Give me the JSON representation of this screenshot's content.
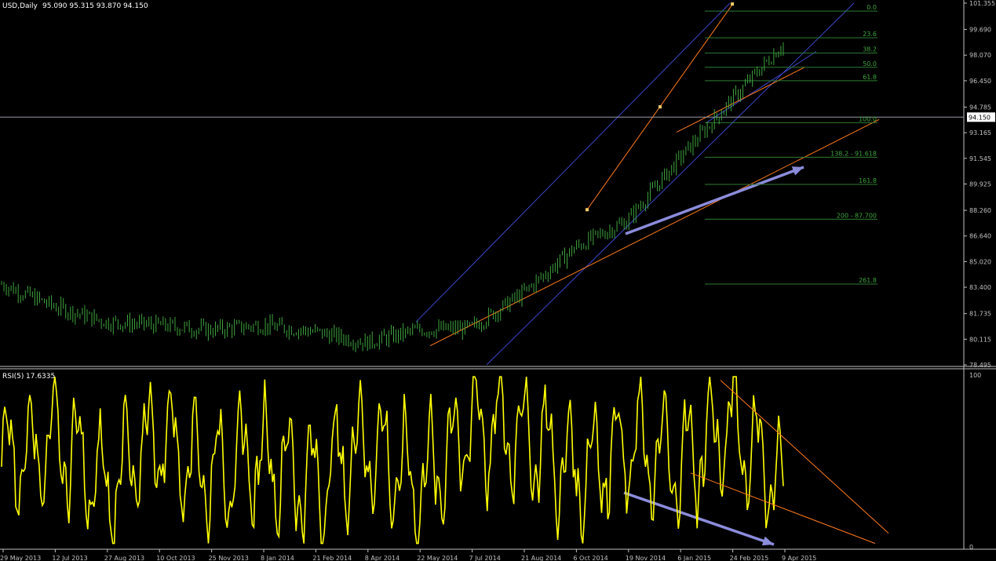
{
  "header": {
    "main_title": "USD,Daily",
    "ohlc": "95.090 95.315 93.870 94.150",
    "rsi_title": "RSI(5)",
    "rsi_value": "17.6335"
  },
  "colors": {
    "background": "#000000",
    "axis": "#c0c0c0",
    "candles": "#3fa53f",
    "rsi_line": "#ffff00",
    "channel": "#3c46c8",
    "trend": "#ff7a1a",
    "fib": "#2e7d32",
    "fib_text": "#3fa53f",
    "arrows": "#8c8cdc"
  },
  "chart_data": [
    {
      "type": "line",
      "title": "USD,Daily",
      "series": [
        {
          "name": "",
          "x": [
            "29 May 2013",
            "12 Jul 2013",
            "27 Aug 2013",
            "10 Oct 2013",
            "25 Nov 2013",
            "8 Jan 2014",
            "21 Feb 2014",
            "8 Apr 2014",
            "22 May 2014",
            "7 Jul 2014",
            "21 Aug 2014",
            "6 Oct 2014",
            "19 Nov 2014",
            "6 Jan 2015",
            "24 Feb 2015",
            "9 Apr 2015"
          ],
          "values": [
            83.6,
            82.2,
            81.2,
            81.0,
            80.7,
            81.0,
            80.6,
            79.9,
            80.7,
            80.8,
            83.0,
            85.9,
            87.6,
            91.5,
            95.2,
            98.8
          ]
        }
      ],
      "last_close": 94.15,
      "ylim": [
        78.495,
        101.355
      ],
      "y_ticks": [
        "101.355",
        "99.690",
        "98.070",
        "96.450",
        "94.785",
        "93.165",
        "91.545",
        "89.925",
        "88.260",
        "86.640",
        "85.020",
        "83.400",
        "81.735",
        "80.115",
        "78.495"
      ],
      "x_ticks": [
        "29 May 2013",
        "12 Jul 2013",
        "27 Aug 2013",
        "10 Oct 2013",
        "25 Nov 2013",
        "8 Jan 2014",
        "21 Feb 2014",
        "8 Apr 2014",
        "22 May 2014",
        "7 Jul 2014",
        "21 Aug 2014",
        "6 Oct 2014",
        "19 Nov 2014",
        "6 Jan 2015",
        "24 Feb 2015",
        "9 Apr 2015"
      ],
      "fibonacci_levels": [
        {
          "label": "0.0",
          "value": 100.85
        },
        {
          "label": "23.6",
          "value": 99.17
        },
        {
          "label": "38.2",
          "value": 98.2
        },
        {
          "label": "50.0",
          "value": 97.3
        },
        {
          "label": "61.8",
          "value": 96.45
        },
        {
          "label": "100.0",
          "value": 93.8
        },
        {
          "label": "138.2 - 91.618",
          "value": 91.618
        },
        {
          "label": "161.8",
          "value": 89.9
        },
        {
          "label": "200 - 87.700",
          "value": 87.7
        },
        {
          "label": "261.8",
          "value": 83.6
        }
      ]
    },
    {
      "type": "line",
      "title": "RSI(5)",
      "series": [
        {
          "name": "",
          "x": [
            "29 May 2013",
            "12 Jul 2013",
            "27 Aug 2013",
            "10 Oct 2013",
            "25 Nov 2013",
            "8 Jan 2014",
            "21 Feb 2014",
            "8 Apr 2014",
            "22 May 2014",
            "7 Jul 2014",
            "21 Aug 2014",
            "6 Oct 2014",
            "19 Nov 2014",
            "6 Jan 2015",
            "24 Feb 2015",
            "9 Apr 2015"
          ],
          "values": [
            40,
            82,
            12,
            85,
            35,
            55,
            20,
            75,
            15,
            95,
            88,
            35,
            70,
            45,
            98,
            17.6
          ]
        }
      ],
      "ylim": [
        0,
        100
      ],
      "y_ticks": [
        "100",
        "0"
      ]
    }
  ]
}
